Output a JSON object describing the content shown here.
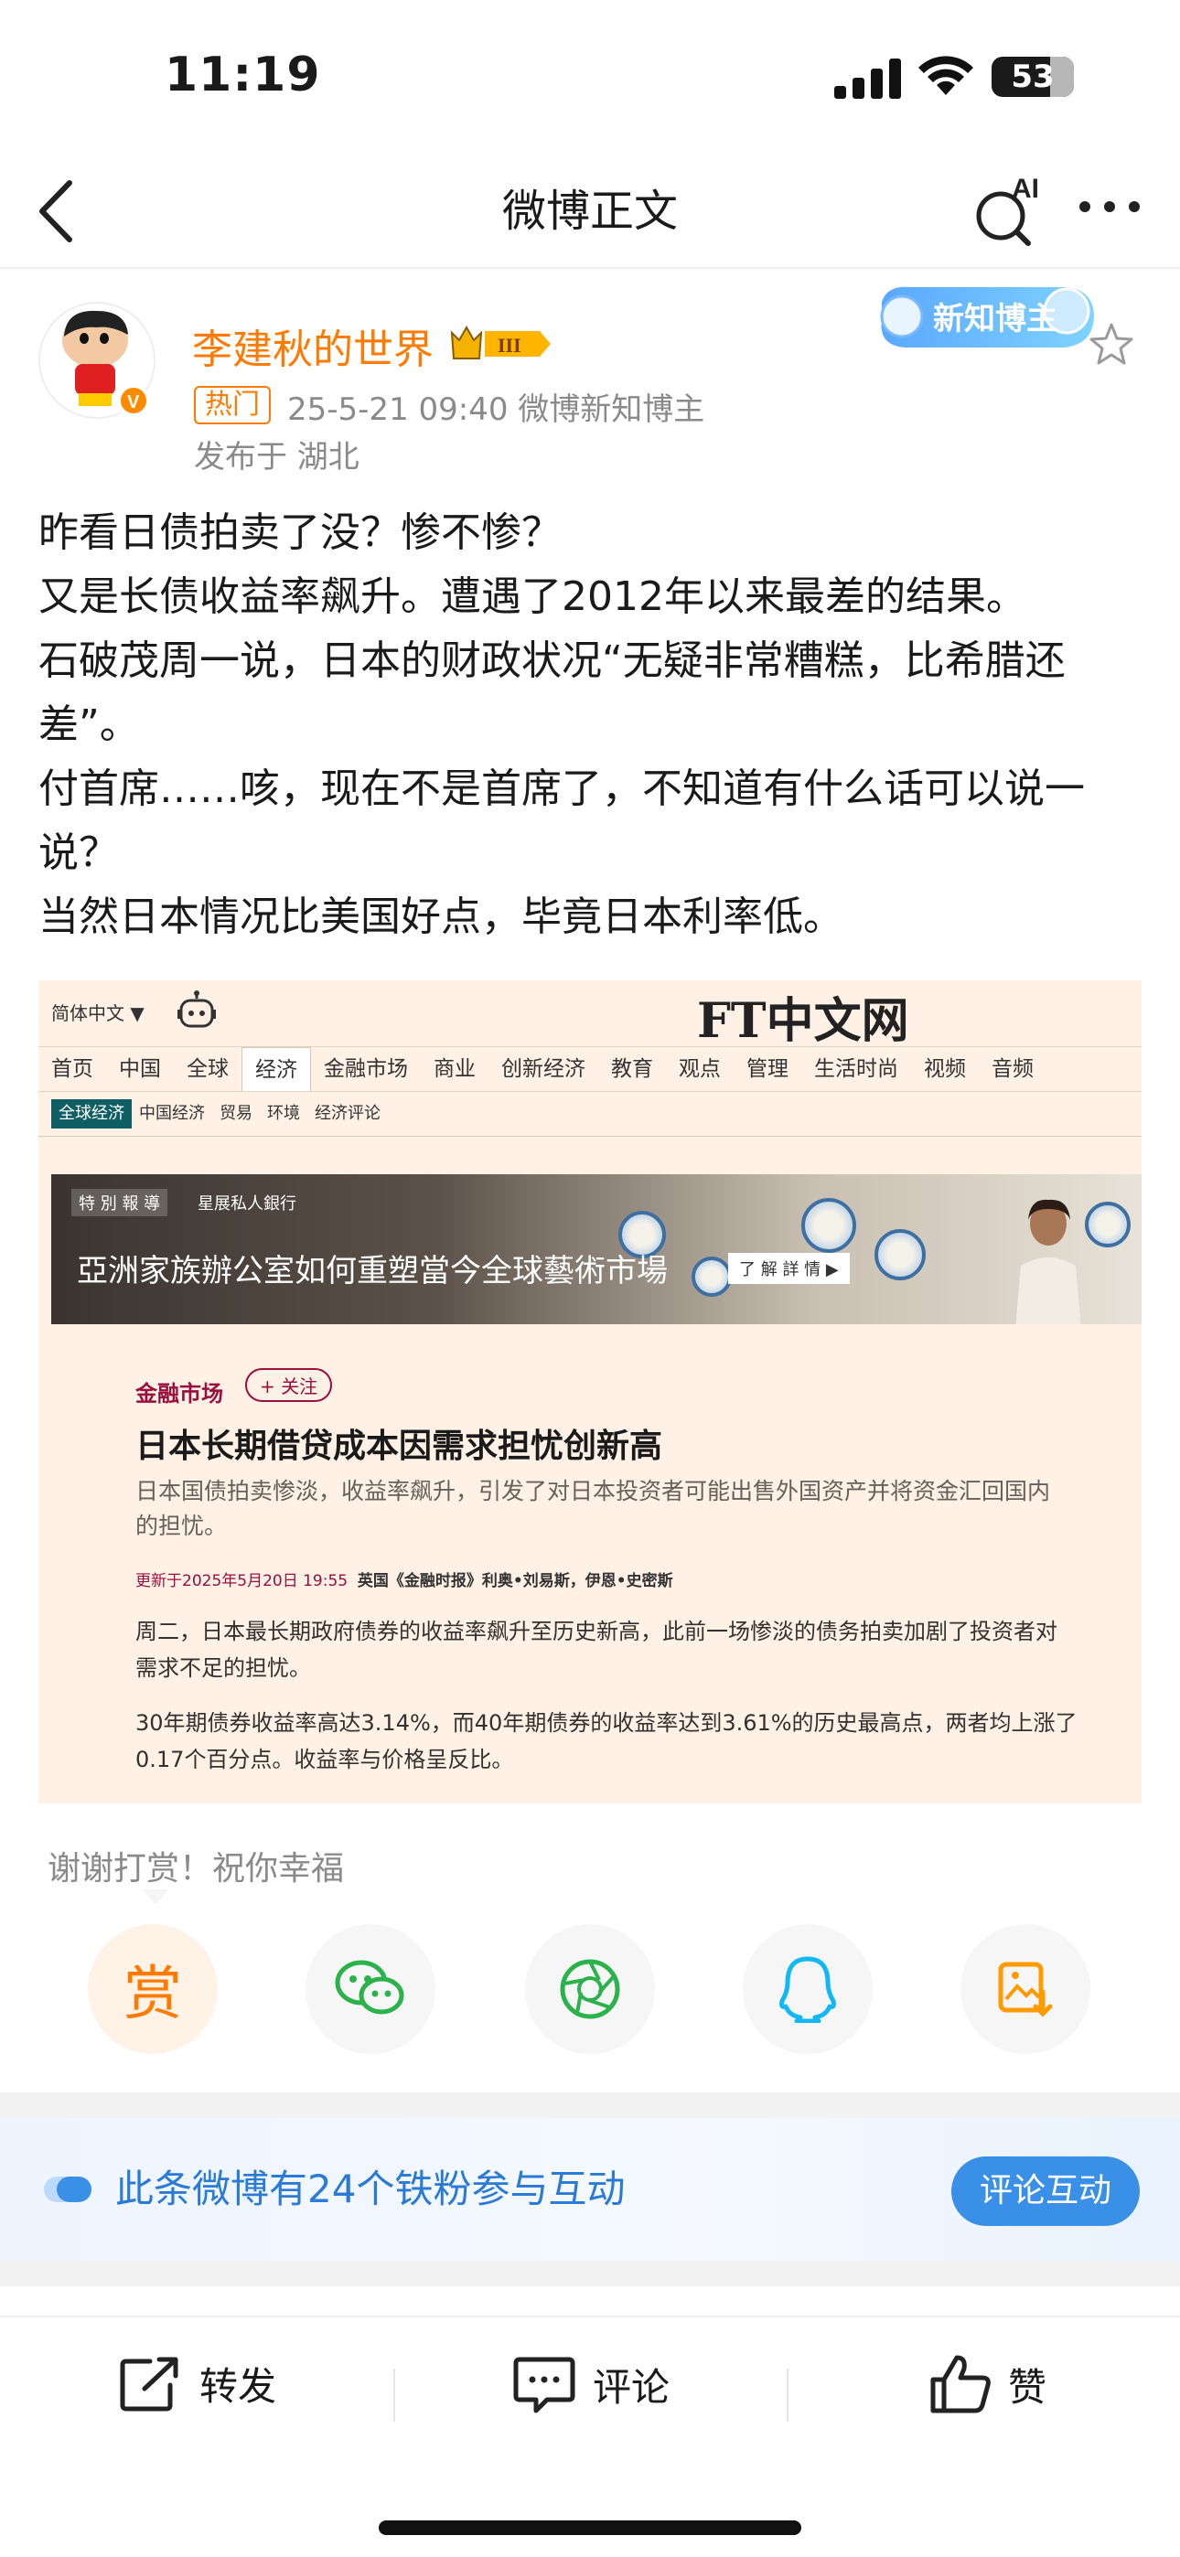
{
  "status_bar": {
    "time": "11:19",
    "battery": "53"
  },
  "nav": {
    "title": "微博正文",
    "ai_label": "AI"
  },
  "author": {
    "name": "李建秋的世界",
    "level_badge": "III",
    "hot_tag": "热门",
    "meta": "25-5-21 09:40  微博新知博主",
    "location": "发布于 湖北",
    "creator_badge": "新知博主"
  },
  "post": {
    "lines": [
      "昨看日债拍卖了没？惨不惨？",
      "又是长债收益率飙升。遭遇了2012年以来最差的结果。",
      "石破茂周一说，日本的财政状况“无疑非常糟糕，比希腊还差”。",
      "付首席……咳，现在不是首席了，不知道有什么话可以说一说？",
      "当然日本情况比美国好点，毕竟日本利率低。"
    ]
  },
  "ft": {
    "lang": "简体中文 ▼",
    "logo": "FT中文网",
    "nav": [
      "首页",
      "中国",
      "全球",
      "经济",
      "金融市场",
      "商业",
      "创新经济",
      "教育",
      "观点",
      "管理",
      "生活时尚",
      "视频",
      "音频"
    ],
    "subnav": [
      "全球经济",
      "中国经济",
      "贸易",
      "环境",
      "经济评论"
    ],
    "banner_tag": "特 別 報 導",
    "banner_sponsor": "星展私人銀行",
    "banner_title": "亞洲家族辦公室如何重塑當今全球藝術市場",
    "banner_btn": "了 解 詳 情 ▶",
    "section": "金融市场",
    "follow": "+ 关注",
    "headline": "日本长期借贷成本因需求担忧创新高",
    "standfirst": "日本国债拍卖惨淡，收益率飙升，引发了对日本投资者可能出售外国资产并将资金汇回国内的担忧。",
    "byline_date": "更新于2025年5月20日 19:55",
    "byline_authors": "英国《金融时报》利奥•刘易斯，伊恩•史密斯",
    "p1": "周二，日本最长期政府债券的收益率飙升至历史新高，此前一场惨淡的债务拍卖加剧了投资者对需求不足的担忧。",
    "p2": "30年期债券收益率高达3.14%，而40年期债券的收益率达到3.61%的历史最高点，两者均上涨了0.17个百分点。收益率与价格呈反比。"
  },
  "reward": {
    "text": "谢谢打赏！祝你幸福",
    "reward_label": "赏"
  },
  "fan": {
    "text": "此条微博有24个铁粉参与互动",
    "button": "评论互动"
  },
  "actions": {
    "repost": "转发",
    "comment": "评论",
    "like": "赞"
  },
  "colors": {
    "accent_orange": "#ff7a00",
    "weibo_blue": "#3a8fe6",
    "ft_bg": "#fff1e5",
    "ft_claret": "#990f3d"
  }
}
